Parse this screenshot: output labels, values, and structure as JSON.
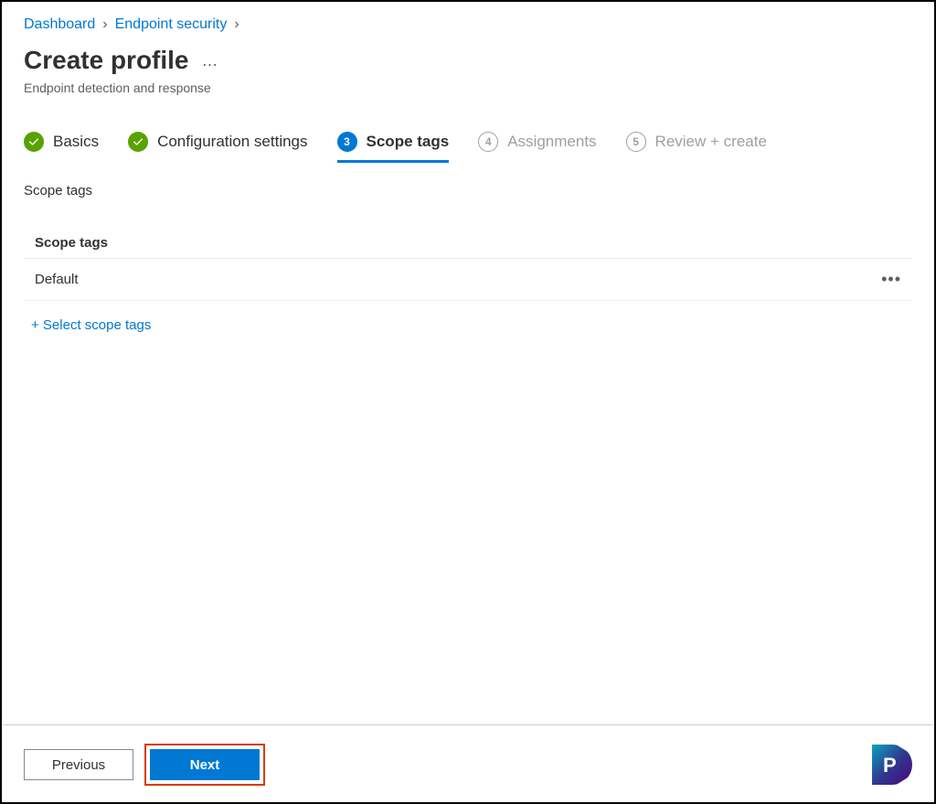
{
  "breadcrumb": {
    "items": [
      "Dashboard",
      "Endpoint security"
    ]
  },
  "header": {
    "title": "Create profile",
    "subtitle": "Endpoint detection and response"
  },
  "stepper": {
    "steps": [
      {
        "label": "Basics",
        "state": "complete"
      },
      {
        "label": "Configuration settings",
        "state": "complete"
      },
      {
        "label": "Scope tags",
        "state": "active",
        "number": "3"
      },
      {
        "label": "Assignments",
        "state": "future",
        "number": "4"
      },
      {
        "label": "Review + create",
        "state": "future",
        "number": "5"
      }
    ]
  },
  "section": {
    "label": "Scope tags",
    "table_header": "Scope tags",
    "rows": [
      {
        "name": "Default"
      }
    ],
    "select_link": "+ Select scope tags"
  },
  "footer": {
    "previous": "Previous",
    "next": "Next"
  }
}
